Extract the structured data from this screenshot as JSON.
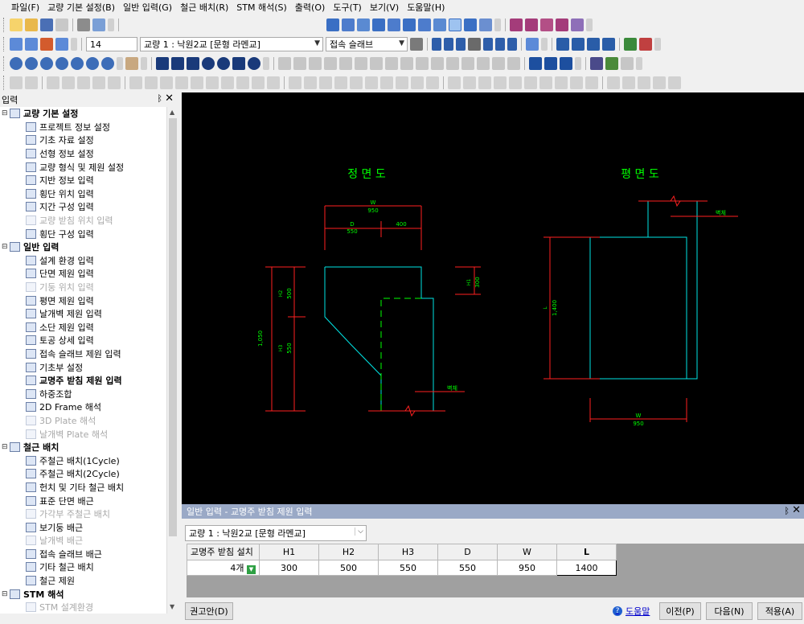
{
  "menu": [
    "파일(F)",
    "교량 기본 설정(B)",
    "일반 입력(G)",
    "철근 배치(R)",
    "STM 해석(S)",
    "출력(O)",
    "도구(T)",
    "보기(V)",
    "도움말(H)"
  ],
  "toolbar2": {
    "scale_value": "14",
    "bridge_combo": "교량 1 : 낙원2교 [문형 라멘교]",
    "item_combo": "접속 슬래브"
  },
  "left_panel": {
    "title": "입력",
    "pin": "ㅁ",
    "close": "✕",
    "tree": [
      {
        "type": "group",
        "label": "교량 기본 설정"
      },
      {
        "type": "child",
        "label": "프로젝트 정보 설정"
      },
      {
        "type": "child",
        "label": "기초 자료 설정"
      },
      {
        "type": "child",
        "label": "선형 정보 설정"
      },
      {
        "type": "child",
        "label": "교량 형식 및 제원 설정"
      },
      {
        "type": "child",
        "label": "지반 정보 입력"
      },
      {
        "type": "child",
        "label": "횡단 위치 입력"
      },
      {
        "type": "child",
        "label": "지간 구성 입력"
      },
      {
        "type": "child",
        "label": "교량 받침 위치 입력",
        "disabled": true
      },
      {
        "type": "child",
        "label": "횡단 구성 입력"
      },
      {
        "type": "group",
        "label": "일반 입력"
      },
      {
        "type": "child",
        "label": "설계 환경 입력"
      },
      {
        "type": "child",
        "label": "단면 제원 입력"
      },
      {
        "type": "child",
        "label": "기둥 위치 입력",
        "disabled": true
      },
      {
        "type": "child",
        "label": "평면 제원 입력"
      },
      {
        "type": "child",
        "label": "날개벽 제원 입력"
      },
      {
        "type": "child",
        "label": "소단 제원 입력"
      },
      {
        "type": "child",
        "label": "토공 상세 입력"
      },
      {
        "type": "child",
        "label": "접속 슬래브 제원 입력"
      },
      {
        "type": "child",
        "label": "기초부 설정"
      },
      {
        "type": "child",
        "label": "교명주 받침 제원 입력",
        "selected": true
      },
      {
        "type": "child",
        "label": "하중조합"
      },
      {
        "type": "child",
        "label": "2D Frame 해석"
      },
      {
        "type": "child",
        "label": "3D Plate 해석",
        "disabled": true
      },
      {
        "type": "child",
        "label": "날개벽 Plate 해석",
        "disabled": true
      },
      {
        "type": "group",
        "label": "철근 배치"
      },
      {
        "type": "child",
        "label": "주철근 배치(1Cycle)"
      },
      {
        "type": "child",
        "label": "주철근 배치(2Cycle)"
      },
      {
        "type": "child",
        "label": "헌치 및 기타 철근 배치"
      },
      {
        "type": "child",
        "label": "표준 단면 배근"
      },
      {
        "type": "child",
        "label": "가각부 주철근 배치",
        "disabled": true
      },
      {
        "type": "child",
        "label": "보기둥 배근"
      },
      {
        "type": "child",
        "label": "날개벽 배근",
        "disabled": true
      },
      {
        "type": "child",
        "label": "접속 슬래브 배근"
      },
      {
        "type": "child",
        "label": "기타 철근 배치"
      },
      {
        "type": "child",
        "label": "철근 제원"
      },
      {
        "type": "group",
        "label": "STM 해석"
      },
      {
        "type": "child",
        "label": "STM 설계환경",
        "disabled": true
      }
    ]
  },
  "drawing": {
    "front_title": "정 면 도",
    "plan_title": "평 면 도",
    "front_W_label": "W",
    "front_W_value": "950",
    "front_D_label": "D",
    "front_D_value": "550",
    "front_400": "400",
    "front_H1": "H1",
    "front_H1_value": "300",
    "front_H2": "H2",
    "front_H2_value": "500",
    "front_H3": "H3",
    "front_H3_value": "550",
    "front_total": "1,050",
    "front_wall_tag": "벽체",
    "plan_L": "L",
    "plan_L_value": "1,400",
    "plan_W_label": "W",
    "plan_W_value": "950",
    "plan_wall_tag": "벽체",
    "colors": {
      "green": "#00ff00",
      "cyan": "#00e5e5",
      "red": "#ff2020"
    }
  },
  "bottom_panel": {
    "title": "일반 입력 - 교명주 받침 제원 입력",
    "bridge_select": "교량 1 : 낙원2교 [문형 라멘교]",
    "headers": [
      "교명주 받침 설치",
      "H1",
      "H2",
      "H3",
      "D",
      "W",
      "L"
    ],
    "row": {
      "count": "4개",
      "H1": "300",
      "H2": "500",
      "H3": "550",
      "D": "550",
      "W": "950",
      "L": "1400"
    },
    "recommend_button": "권고안(D)",
    "help_link": "도움말",
    "prev_button": "이전(P)",
    "next_button": "다음(N)",
    "apply_button": "적용(A)"
  }
}
